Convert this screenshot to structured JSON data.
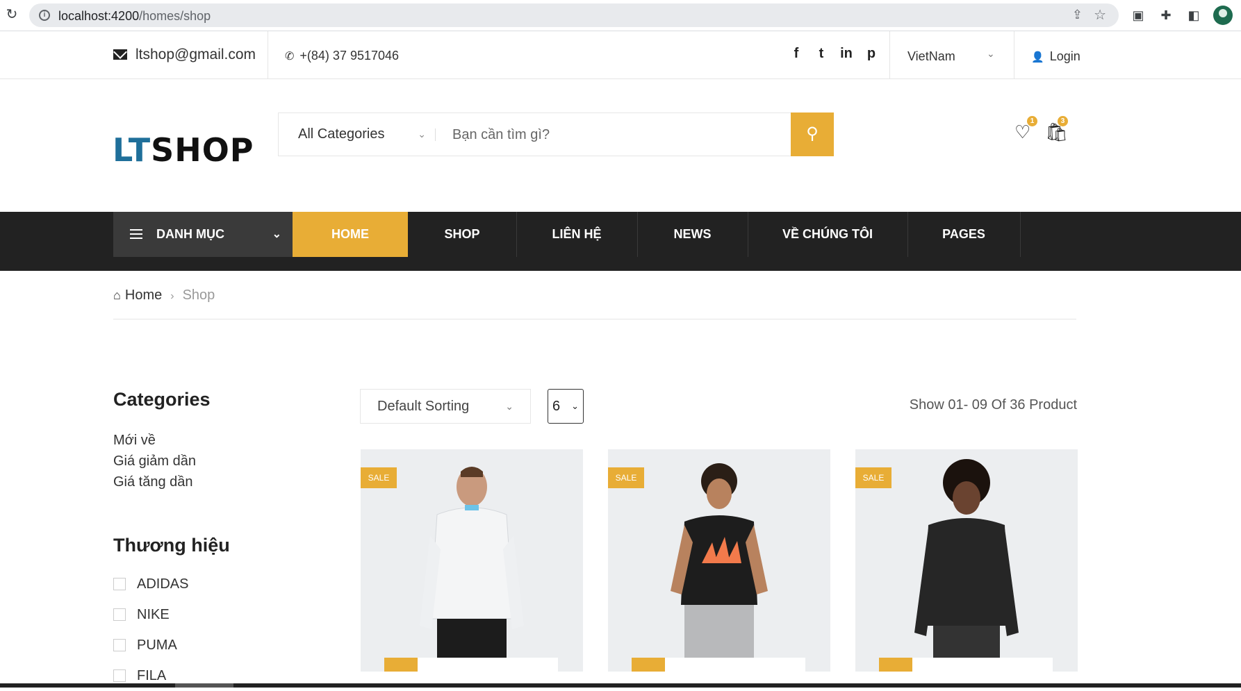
{
  "browser": {
    "url_host": "localhost:4200",
    "url_path": "/homes/shop"
  },
  "topbar": {
    "email": "ltshop@gmail.com",
    "phone": "+(84) 37 9517046",
    "social": [
      "f",
      "t",
      "in",
      "p"
    ],
    "country": "VietNam",
    "login": "Login"
  },
  "header": {
    "logo_lt": "LT",
    "logo_shop": "SHOP",
    "category_select": "All Categories",
    "search_placeholder": "Bạn cần tìm gì?",
    "wishlist_count": "1",
    "cart_count": "3"
  },
  "nav": {
    "categories_label": "DANH MỤC",
    "items": [
      "HOME",
      "SHOP",
      "LIÊN HỆ",
      "NEWS",
      "VỀ CHÚNG TÔI",
      "PAGES"
    ]
  },
  "breadcrumb": {
    "home": "Home",
    "current": "Shop"
  },
  "sidebar": {
    "categories_title": "Categories",
    "categories": [
      "Mới về",
      "Giá giảm dần",
      "Giá tăng dần"
    ],
    "brands_title": "Thương hiệu",
    "brands": [
      "ADIDAS",
      "NIKE",
      "PUMA",
      "FILA"
    ]
  },
  "toolbar": {
    "sorting": "Default Sorting",
    "per_page": "6",
    "show_count": "Show 01- 09 Of 36 Product"
  },
  "products": [
    {
      "badge": "SALE",
      "image": "white-jacket-model"
    },
    {
      "badge": "SALE",
      "image": "black-adidas-tee-model"
    },
    {
      "badge": "SALE",
      "image": "black-sweatshirt-model"
    }
  ],
  "colors": {
    "accent": "#e8ad36",
    "nav_bg": "#222222",
    "logo_blue": "#1f6f9a"
  }
}
